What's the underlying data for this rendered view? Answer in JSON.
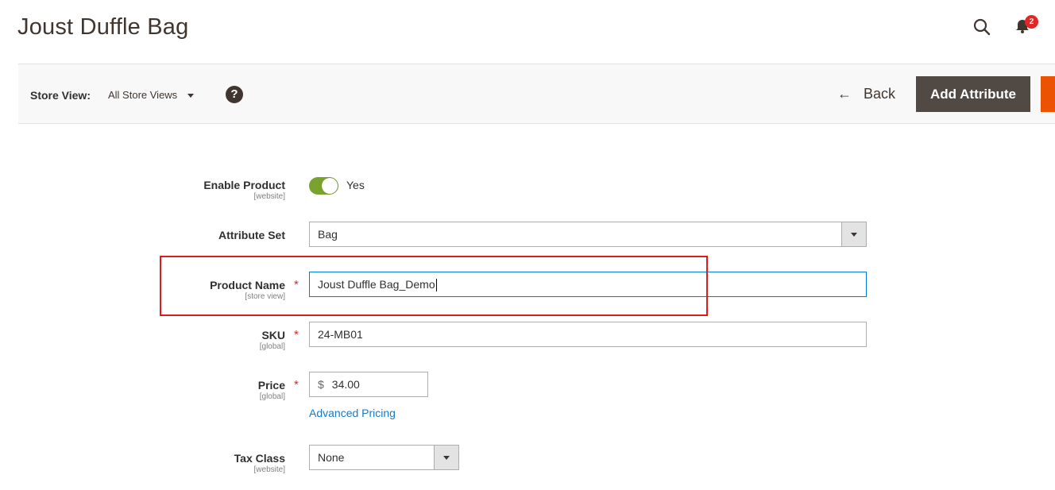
{
  "header": {
    "title": "Joust Duffle Bag",
    "notifications_count": "2"
  },
  "toolbar": {
    "store_view_label": "Store View:",
    "store_view_value": "All Store Views",
    "help_glyph": "?",
    "back_label": "Back",
    "add_attribute_label": "Add Attribute"
  },
  "form": {
    "enable_product": {
      "label": "Enable Product",
      "scope": "[website]",
      "value": "Yes",
      "on": true
    },
    "attribute_set": {
      "label": "Attribute Set",
      "value": "Bag"
    },
    "product_name": {
      "label": "Product Name",
      "scope": "[store view]",
      "value": "Joust Duffle Bag_Demo",
      "required": "*"
    },
    "sku": {
      "label": "SKU",
      "scope": "[global]",
      "value": "24-MB01",
      "required": "*"
    },
    "price": {
      "label": "Price",
      "scope": "[global]",
      "currency": "$",
      "value": "34.00",
      "required": "*",
      "advanced_link": "Advanced Pricing"
    },
    "tax_class": {
      "label": "Tax Class",
      "scope": "[website]",
      "value": "None"
    }
  },
  "colors": {
    "primary_button": "#514943",
    "save_button": "#eb5202",
    "toggle_on": "#79a22e",
    "required": "#e22626",
    "link": "#1979c3",
    "highlight": "#e01b1b"
  }
}
